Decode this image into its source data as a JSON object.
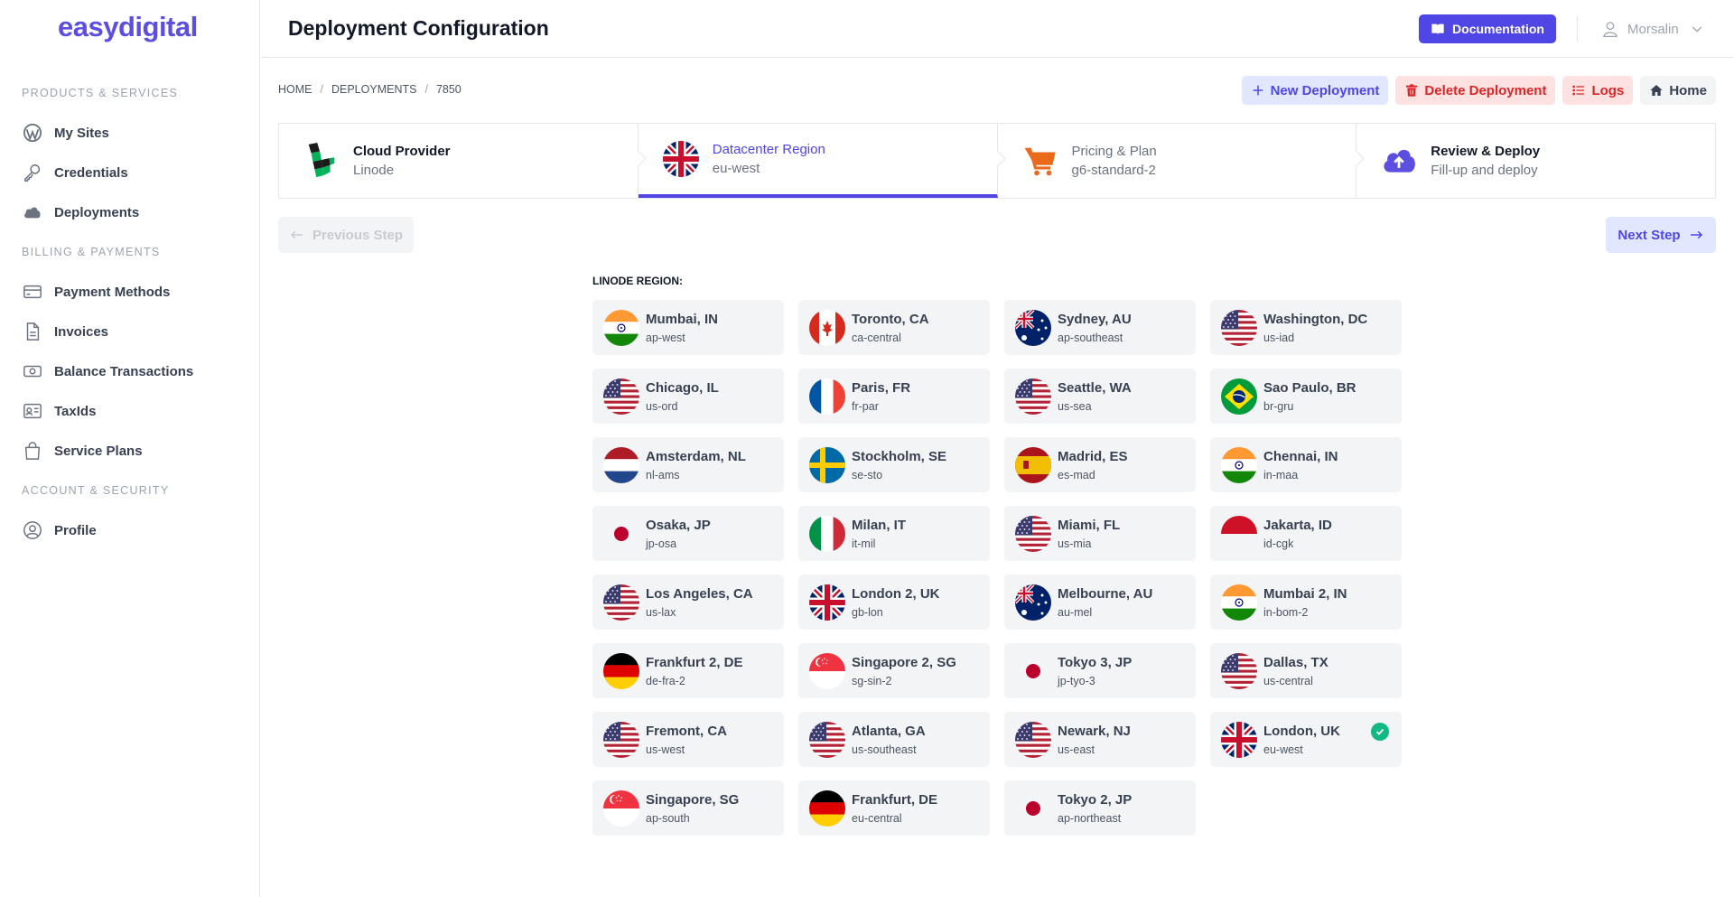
{
  "brand": {
    "logo_text": "easydigital"
  },
  "sidebar": {
    "sections": [
      {
        "label": "PRODUCTS & SERVICES"
      },
      {
        "label": "BILLING & PAYMENTS"
      },
      {
        "label": "ACCOUNT & SECURITY"
      }
    ],
    "items": [
      {
        "label": "My Sites",
        "icon": "wordpress-icon"
      },
      {
        "label": "Credentials",
        "icon": "key-icon"
      },
      {
        "label": "Deployments",
        "icon": "cloud-icon"
      },
      {
        "label": "Payment Methods",
        "icon": "credit-card-icon"
      },
      {
        "label": "Invoices",
        "icon": "document-icon"
      },
      {
        "label": "Balance Transactions",
        "icon": "cash-icon"
      },
      {
        "label": "TaxIds",
        "icon": "id-card-icon"
      },
      {
        "label": "Service Plans",
        "icon": "shopping-bag-icon"
      },
      {
        "label": "Profile",
        "icon": "user-circle-icon"
      }
    ]
  },
  "header": {
    "title": "Deployment Configuration",
    "documentation_label": "Documentation",
    "user_name": "Morsalin"
  },
  "breadcrumb": [
    "HOME",
    "DEPLOYMENTS",
    "7850"
  ],
  "actions": {
    "new_deployment": "New Deployment",
    "delete_deployment": "Delete Deployment",
    "logs": "Logs",
    "home": "Home"
  },
  "steps": [
    {
      "title": "Cloud Provider",
      "subtitle": "Linode",
      "icon": "linode-logo-icon"
    },
    {
      "title": "Datacenter Region",
      "subtitle": "eu-west",
      "icon": "uk-flag-icon"
    },
    {
      "title": "Pricing & Plan",
      "subtitle": "g6-standard-2",
      "icon": "cart-icon"
    },
    {
      "title": "Review & Deploy",
      "subtitle": "Fill-up and deploy",
      "icon": "cloud-upload-icon"
    }
  ],
  "nav": {
    "previous": "Previous Step",
    "next": "Next Step"
  },
  "regions": {
    "label": "LINODE REGION:",
    "selected": "eu-west",
    "items": [
      {
        "name": "Mumbai, IN",
        "code": "ap-west",
        "flag": "in"
      },
      {
        "name": "Toronto, CA",
        "code": "ca-central",
        "flag": "ca"
      },
      {
        "name": "Sydney, AU",
        "code": "ap-southeast",
        "flag": "au"
      },
      {
        "name": "Washington, DC",
        "code": "us-iad",
        "flag": "us"
      },
      {
        "name": "Chicago, IL",
        "code": "us-ord",
        "flag": "us"
      },
      {
        "name": "Paris, FR",
        "code": "fr-par",
        "flag": "fr"
      },
      {
        "name": "Seattle, WA",
        "code": "us-sea",
        "flag": "us"
      },
      {
        "name": "Sao Paulo, BR",
        "code": "br-gru",
        "flag": "br"
      },
      {
        "name": "Amsterdam, NL",
        "code": "nl-ams",
        "flag": "nl"
      },
      {
        "name": "Stockholm, SE",
        "code": "se-sto",
        "flag": "se"
      },
      {
        "name": "Madrid, ES",
        "code": "es-mad",
        "flag": "es"
      },
      {
        "name": "Chennai, IN",
        "code": "in-maa",
        "flag": "in"
      },
      {
        "name": "Osaka, JP",
        "code": "jp-osa",
        "flag": "jp"
      },
      {
        "name": "Milan, IT",
        "code": "it-mil",
        "flag": "it"
      },
      {
        "name": "Miami, FL",
        "code": "us-mia",
        "flag": "us"
      },
      {
        "name": "Jakarta, ID",
        "code": "id-cgk",
        "flag": "id"
      },
      {
        "name": "Los Angeles, CA",
        "code": "us-lax",
        "flag": "us"
      },
      {
        "name": "London 2, UK",
        "code": "gb-lon",
        "flag": "gb"
      },
      {
        "name": "Melbourne, AU",
        "code": "au-mel",
        "flag": "au"
      },
      {
        "name": "Mumbai 2, IN",
        "code": "in-bom-2",
        "flag": "in"
      },
      {
        "name": "Frankfurt 2, DE",
        "code": "de-fra-2",
        "flag": "de"
      },
      {
        "name": "Singapore 2, SG",
        "code": "sg-sin-2",
        "flag": "sg"
      },
      {
        "name": "Tokyo 3, JP",
        "code": "jp-tyo-3",
        "flag": "jp"
      },
      {
        "name": "Dallas, TX",
        "code": "us-central",
        "flag": "us"
      },
      {
        "name": "Fremont, CA",
        "code": "us-west",
        "flag": "us"
      },
      {
        "name": "Atlanta, GA",
        "code": "us-southeast",
        "flag": "us"
      },
      {
        "name": "Newark, NJ",
        "code": "us-east",
        "flag": "us"
      },
      {
        "name": "London, UK",
        "code": "eu-west",
        "flag": "gb"
      },
      {
        "name": "Singapore, SG",
        "code": "ap-south",
        "flag": "sg"
      },
      {
        "name": "Frankfurt, DE",
        "code": "eu-central",
        "flag": "de"
      },
      {
        "name": "Tokyo 2, JP",
        "code": "ap-northeast",
        "flag": "jp"
      }
    ]
  },
  "colors": {
    "accent": "#4f46e5",
    "logo": "#5b4ee0",
    "danger": "#dc2626",
    "success": "#10b981",
    "card_bg": "#f3f4f6"
  }
}
